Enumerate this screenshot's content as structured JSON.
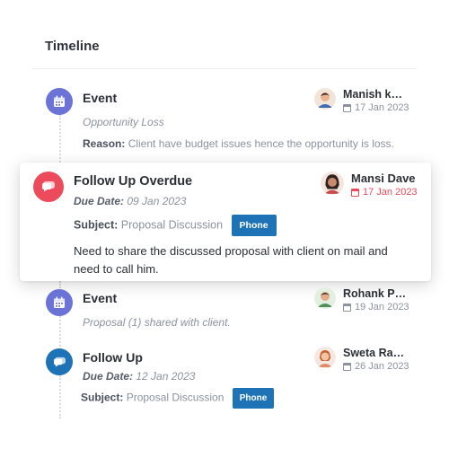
{
  "page_title": "Timeline",
  "colors": {
    "event": "#6b73d6",
    "overdue": "#ec4b5c",
    "followup": "#1d73b5",
    "phone_button": "#1d73b5"
  },
  "items": [
    {
      "type": "event",
      "icon": "calendar-icon",
      "title": "Event",
      "subtitle": "Opportunity Loss",
      "reason_label": "Reason:",
      "reason": "Client have budget issues hence the opportunity is loss.",
      "user": {
        "name": "Manish kot...",
        "date": "17 Jan 2023"
      }
    },
    {
      "type": "follow_up_overdue",
      "icon": "chat-bubble-icon",
      "title": "Follow Up Overdue",
      "due_label": "Due Date:",
      "due_date": "09 Jan 2023",
      "subject_label": "Subject:",
      "subject": "Proposal Discussion",
      "button": "Phone",
      "description": "Need to share the discussed proposal with client on mail and need to call him.",
      "user": {
        "name": "Mansi Dave",
        "date": "17 Jan 2023"
      }
    },
    {
      "type": "event",
      "icon": "calendar-icon",
      "title": "Event",
      "subtitle": "Proposal (1) shared with client.",
      "user": {
        "name": "Rohank Pa...",
        "date": "19 Jan 2023"
      }
    },
    {
      "type": "follow_up",
      "icon": "chat-bubble-icon",
      "title": "Follow Up",
      "due_label": "Due Date:",
      "due_date": "12 Jan 2023",
      "subject_label": "Subject:",
      "subject": "Proposal Discussion",
      "button": "Phone",
      "user": {
        "name": "Sweta Rau...",
        "date": "26 Jan 2023"
      }
    }
  ]
}
